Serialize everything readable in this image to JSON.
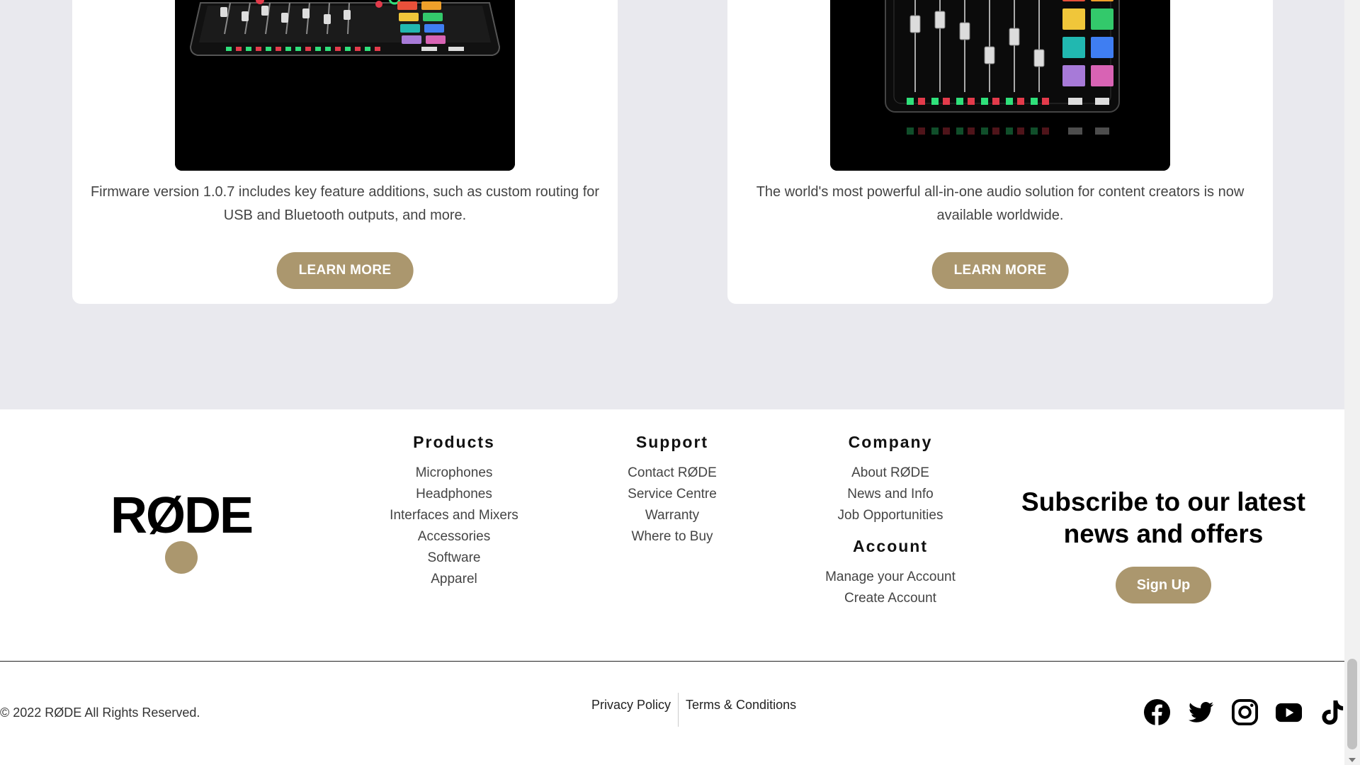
{
  "cards": [
    {
      "image": "mixer-product-image",
      "text": "Firmware version 1.0.7 includes key feature additions, such as custom routing for USB and Bluetooth outputs, and more.",
      "button": "LEARN MORE"
    },
    {
      "image": "mixer-topdown-image",
      "text": "The world's most powerful all-in-one audio solution for content creators is now available worldwide.",
      "button": "LEARN MORE"
    }
  ],
  "footer": {
    "logo": "RØDE",
    "columns": {
      "products": {
        "heading": "Products",
        "links": [
          "Microphones",
          "Headphones",
          "Interfaces and Mixers",
          "Accessories",
          "Software",
          "Apparel"
        ]
      },
      "support": {
        "heading": "Support",
        "links": [
          "Contact RØDE",
          "Service Centre",
          "Warranty",
          "Where to Buy"
        ]
      },
      "company": {
        "heading": "Company",
        "links": [
          "About RØDE",
          "News and Info",
          "Job Opportunities"
        ]
      },
      "account": {
        "heading": "Account",
        "links": [
          "Manage your Account",
          "Create Account"
        ]
      }
    },
    "subscribe": {
      "title": "Subscribe to our latest news and offers",
      "button": "Sign Up"
    },
    "copyright": "© 2022 RØDE All Rights Reserved.",
    "legal": [
      "Privacy Policy",
      "Terms & Conditions"
    ],
    "social": [
      "facebook-icon",
      "twitter-icon",
      "instagram-icon",
      "youtube-icon",
      "tiktok-icon"
    ]
  },
  "colors": {
    "accent": "#ab976e",
    "section_bg": "#e9e9ee",
    "footer_bg": "#ffffff"
  }
}
